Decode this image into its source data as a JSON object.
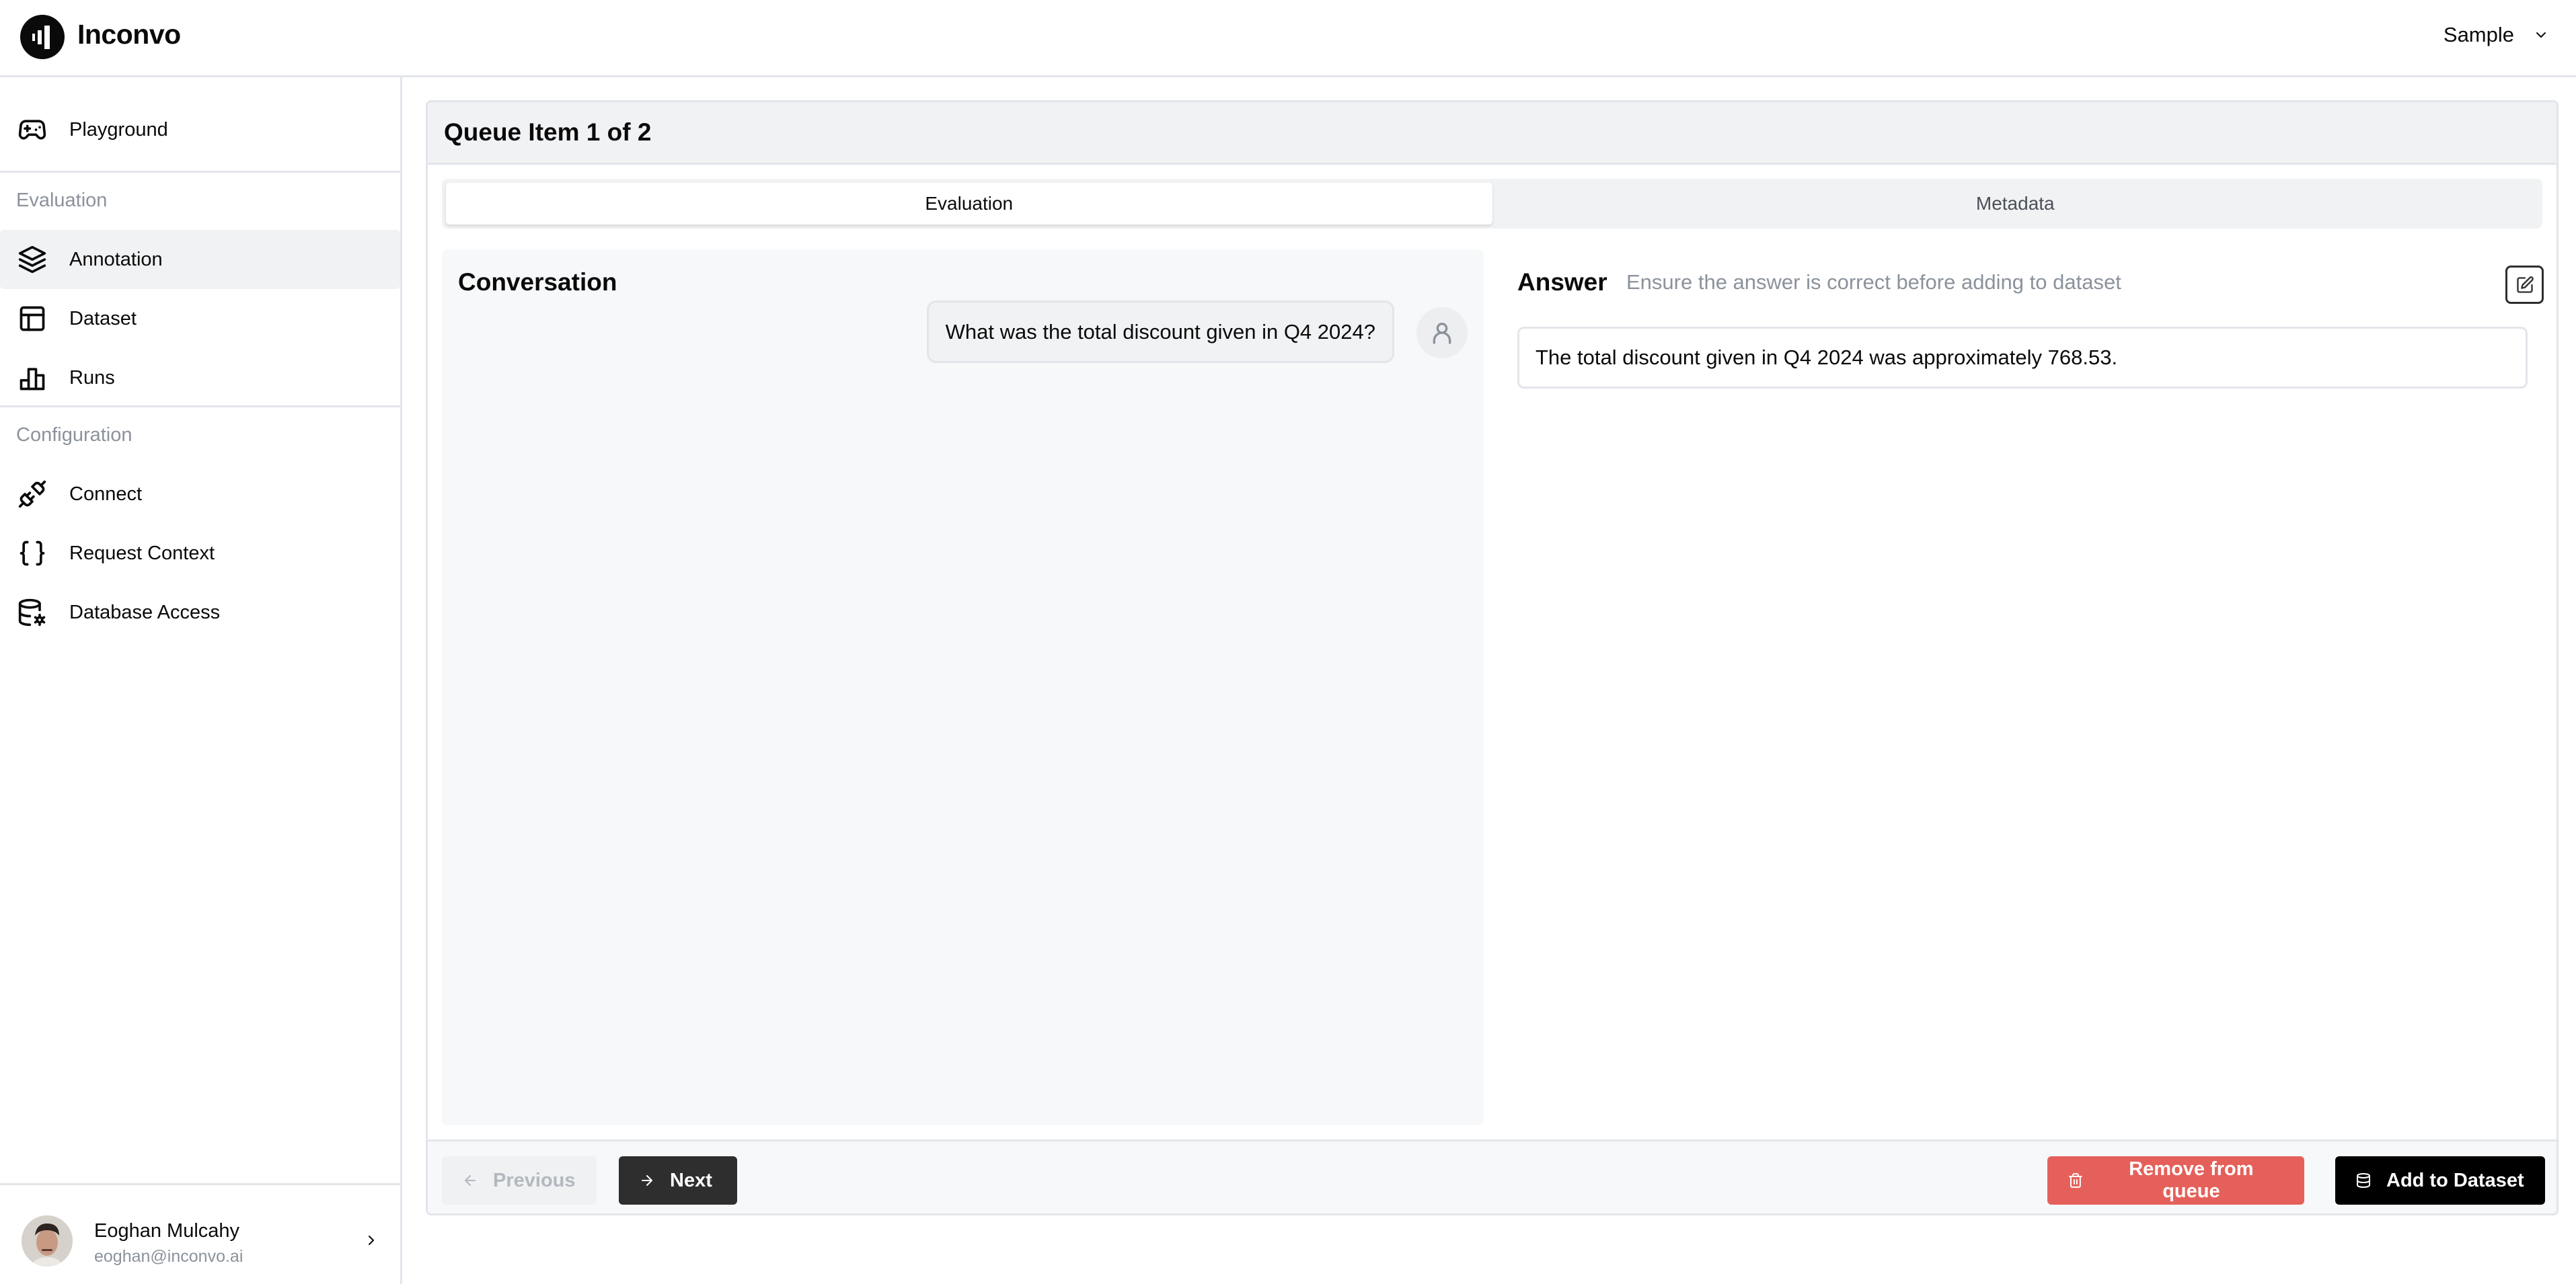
{
  "app": {
    "brand_name": "Inconvo",
    "workspace_selector": {
      "label": "Sample",
      "icon": "chevron-down-icon"
    }
  },
  "sidebar": {
    "top_items": [
      {
        "label": "Playground",
        "icon": "gamepad-icon",
        "active": false
      }
    ],
    "sections": [
      {
        "label": "Evaluation",
        "items": [
          {
            "label": "Annotation",
            "icon": "layers-icon",
            "active": true
          },
          {
            "label": "Dataset",
            "icon": "table-icon",
            "active": false
          },
          {
            "label": "Runs",
            "icon": "bar-chart-icon",
            "active": false
          }
        ]
      },
      {
        "label": "Configuration",
        "items": [
          {
            "label": "Connect",
            "icon": "plug-icon",
            "active": false
          },
          {
            "label": "Request Context",
            "icon": "braces-icon",
            "active": false
          },
          {
            "label": "Database Access",
            "icon": "database-settings-icon",
            "active": false
          }
        ]
      }
    ],
    "user": {
      "name": "Eoghan Mulcahy",
      "email": "eoghan@inconvo.ai"
    }
  },
  "main": {
    "title": "Queue Item 1 of 2",
    "tabs": [
      {
        "label": "Evaluation",
        "active": true
      },
      {
        "label": "Metadata",
        "active": false
      }
    ],
    "conversation": {
      "title": "Conversation",
      "messages": [
        {
          "role": "user",
          "text": "What was the total discount given in Q4 2024?"
        }
      ]
    },
    "answer": {
      "title": "Answer",
      "hint": "Ensure the answer is correct before adding to dataset",
      "text": "The total discount given in Q4 2024 was approximately 768.53."
    },
    "footer": {
      "previous_label": "Previous",
      "next_label": "Next",
      "remove_label": "Remove from queue",
      "add_label": "Add to Dataset"
    }
  },
  "colors": {
    "remove_button": "#e5605a",
    "add_button": "#000000",
    "next_button": "#2e2e2e",
    "active_nav_bg": "#f1f2f4"
  }
}
